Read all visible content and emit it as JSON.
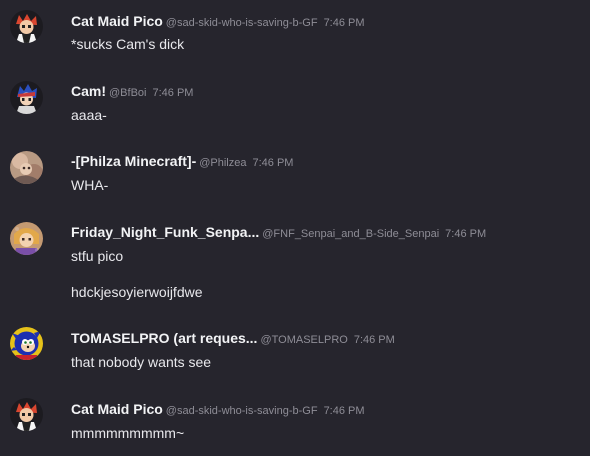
{
  "messages": [
    {
      "name": "Cat Maid Pico",
      "handle": "@sad-skid-who-is-saving-b-GF",
      "time": "7:46 PM",
      "avatar_icon": "pico-avatar-icon",
      "lines": [
        "*sucks Cam's dick"
      ]
    },
    {
      "name": "Cam!",
      "handle": "@BfBoi",
      "time": "7:46 PM",
      "avatar_icon": "boyfriend-avatar-icon",
      "lines": [
        "aaaa-"
      ]
    },
    {
      "name": "-[Philza Minecraft]-",
      "handle": "@Philzea",
      "time": "7:46 PM",
      "avatar_icon": "philza-avatar-icon",
      "lines": [
        "WHA-"
      ]
    },
    {
      "name": "Friday_Night_Funk_Senpa...",
      "handle": "@FNF_Senpai_and_B-Side_Senpai",
      "time": "7:46 PM",
      "avatar_icon": "senpai-avatar-icon",
      "lines": [
        "stfu pico",
        "hdckjesoyierwoijfdwe"
      ]
    },
    {
      "name": "TOMASELPRO (art reques...",
      "handle": "@TOMASELPRO",
      "time": "7:46 PM",
      "avatar_icon": "sonic-avatar-icon",
      "lines": [
        "that nobody wants see"
      ]
    },
    {
      "name": "Cat Maid Pico",
      "handle": "@sad-skid-who-is-saving-b-GF",
      "time": "7:46 PM",
      "avatar_icon": "pico-avatar-icon",
      "lines": [
        "mmmmmmmmm~"
      ]
    }
  ],
  "colors": {
    "background": "#26252d",
    "username": "#f2f3f5",
    "meta": "#8e8d96",
    "message_text": "#e8e8ec"
  }
}
